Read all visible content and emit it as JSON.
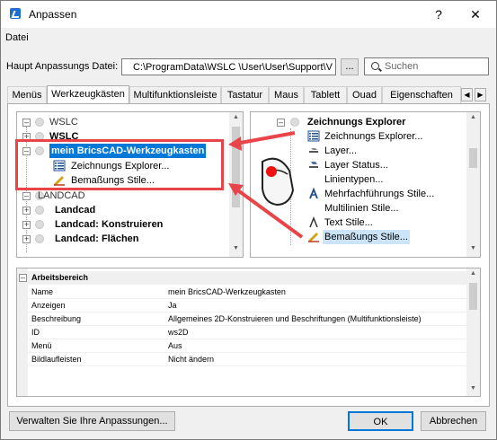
{
  "window": {
    "title": "Anpassen",
    "help_btn": "?",
    "close_btn": "✕"
  },
  "menu": {
    "file": "Datei"
  },
  "path_row": {
    "label": "Haupt Anpassungs Datei:",
    "value": "C:\\ProgramData\\WSLC \\User\\User\\Support\\V",
    "browse": "...",
    "search_placeholder": "Suchen"
  },
  "tabs": [
    "Menüs",
    "Werkzeugkästen",
    "Multifunktionsleiste",
    "Tastatur",
    "Maus",
    "Tablett",
    "Ouad",
    "Eigenschaften"
  ],
  "left_tree": [
    {
      "label": "WSLC",
      "bold": false
    },
    {
      "label": "WSLC",
      "bold": true
    },
    {
      "label": "mein BricsCAD-Werkzeugkasten",
      "bold": true
    },
    {
      "label": "Zeichnungs Explorer...",
      "bold": false
    },
    {
      "label": "Bemaßungs Stile...",
      "bold": false
    },
    {
      "label": "LANDCAD",
      "bold": false
    },
    {
      "label": "Landcad",
      "bold": true
    },
    {
      "label": "Landcad: Konstruieren",
      "bold": true
    },
    {
      "label": "Landcad: Flächen",
      "bold": true
    }
  ],
  "right_tree": [
    {
      "label": "Zeichnungs Explorer",
      "bold": true
    },
    {
      "label": "Zeichnungs Explorer...",
      "bold": false
    },
    {
      "label": "Layer...",
      "bold": false
    },
    {
      "label": "Layer Status...",
      "bold": false
    },
    {
      "label": "Linientypen...",
      "bold": false
    },
    {
      "label": "Mehrfachführungs Stile...",
      "bold": false
    },
    {
      "label": "Multilinien Stile...",
      "bold": false
    },
    {
      "label": "Text Stile...",
      "bold": false
    },
    {
      "label": "Bemaßungs Stile...",
      "bold": false
    }
  ],
  "properties": {
    "section": "Arbeitsbereich",
    "rows": [
      {
        "key": "Name",
        "value": "mein BricsCAD-Werkzeugkasten"
      },
      {
        "key": "Anzeigen",
        "value": "Ja"
      },
      {
        "key": "Beschreibung",
        "value": "Allgemeines 2D-Konstruieren und Beschriftungen (Multifunktionsleiste)"
      },
      {
        "key": "ID",
        "value": "ws2D"
      },
      {
        "key": "Menü",
        "value": "Aus"
      },
      {
        "key": "Bildlaufleisten",
        "value": "Nicht ändern"
      }
    ]
  },
  "buttons": {
    "manage": "Verwalten Sie Ihre Anpassungen...",
    "ok": "OK",
    "cancel": "Abbrechen"
  },
  "colors": {
    "accent": "#0078d7",
    "annotation": "#e8454b"
  }
}
